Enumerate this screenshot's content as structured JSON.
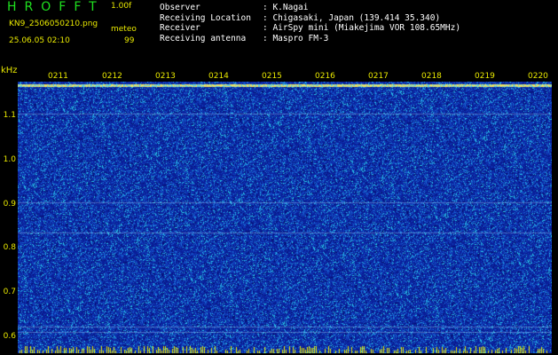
{
  "app_title": "HROFFT",
  "version": "1.00f",
  "filename": "KN9_2506050210.png",
  "meteo_label": "meteo",
  "timestamp": "25.06.05 02:10",
  "count": "99",
  "info": [
    {
      "label": "Observer",
      "value": ": K.Nagai"
    },
    {
      "label": "Receiving Location",
      "value": ": Chigasaki, Japan (139.414 35.340)"
    },
    {
      "label": "Receiver",
      "value": ": AirSpy mini (Miakejima VOR 108.65MHz)"
    },
    {
      "label": "Receiving antenna",
      "value": ": Maspro FM-3"
    }
  ],
  "y_unit": "kHz",
  "y_ticks": [
    "1.1",
    "1.0",
    "0.9",
    "0.8",
    "0.7",
    "0.6"
  ],
  "x_ticks": [
    "0211",
    "0212",
    "0213",
    "0214",
    "0215",
    "0216",
    "0217",
    "0218",
    "0219",
    "0220"
  ],
  "colors": {
    "background": "#000000",
    "label": "#e8e800",
    "title": "#1fe01f",
    "waterfall_base": "#0a1f9a"
  }
}
